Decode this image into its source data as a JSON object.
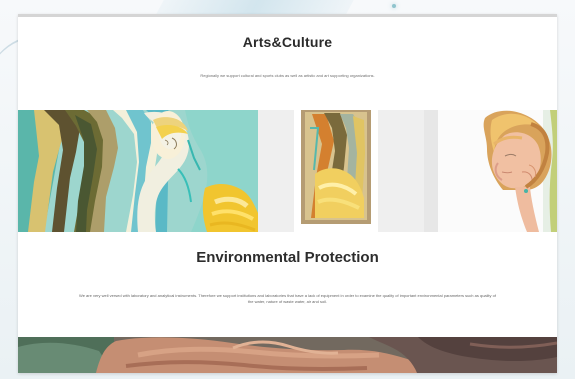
{
  "sections": {
    "arts": {
      "title": "Arts&Culture",
      "description": "Regionally we support cultural and sports clubs as well as artistic and art supporting organizations."
    },
    "environment": {
      "title": "Environmental Protection",
      "description": "We are very well versed with laboratory and analytical instruments. Therefore we support institutions and laboratories that have a lack of equipment in order to examine the quality of important environmental parameters such as quality of the water, nature of waste water, air and soil."
    }
  },
  "images": {
    "left_gallery": "abstract-painting-image",
    "right_gallery": "woman-viewing-painting-image",
    "bottom_strip": "hands-photo-image"
  },
  "colors": {
    "page_background": "#eef3f6",
    "window_background": "#ffffff",
    "title_text": "#2b2b2b",
    "body_text": "#6e6e6e",
    "accent": "#8fc4cd"
  }
}
